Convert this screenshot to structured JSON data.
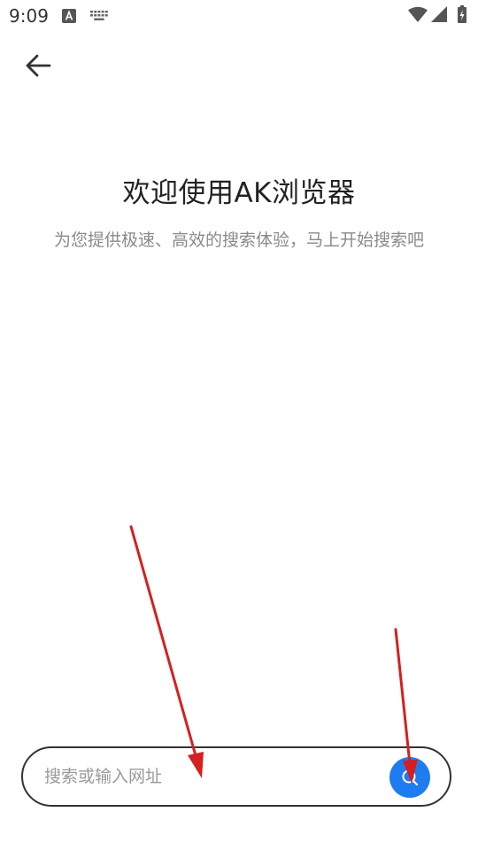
{
  "status_bar": {
    "time": "9:09",
    "icons": [
      "text-input-a-icon",
      "keyboard-icon",
      "wifi-icon",
      "signal-icon",
      "battery-charging-icon"
    ]
  },
  "header": {
    "back_icon": "arrow-left-icon"
  },
  "welcome": {
    "title": "欢迎使用AK浏览器",
    "subtitle": "为您提供极速、高效的搜索体验，马上开始搜索吧"
  },
  "search": {
    "placeholder": "搜索或输入网址",
    "button_icon": "search-icon",
    "button_color": "#1f7cf0"
  },
  "annotations": {
    "arrow_color": "#d42020"
  }
}
